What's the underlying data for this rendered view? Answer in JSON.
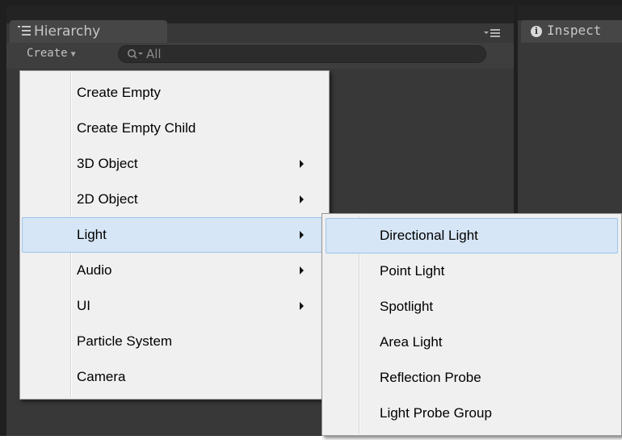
{
  "hierarchy": {
    "tab_label": "Hierarchy",
    "create_label": "Create",
    "search_placeholder": "All"
  },
  "inspector": {
    "tab_label": "Inspect"
  },
  "create_menu": {
    "items": [
      {
        "label": "Create Empty",
        "submenu": false
      },
      {
        "label": "Create Empty Child",
        "submenu": false
      },
      {
        "label": "3D Object",
        "submenu": true
      },
      {
        "label": "2D Object",
        "submenu": true
      },
      {
        "label": "Light",
        "submenu": true,
        "highlighted": true
      },
      {
        "label": "Audio",
        "submenu": true
      },
      {
        "label": "UI",
        "submenu": true
      },
      {
        "label": "Particle System",
        "submenu": false
      },
      {
        "label": "Camera",
        "submenu": false
      }
    ]
  },
  "light_submenu": {
    "items": [
      {
        "label": "Directional Light",
        "highlighted": true
      },
      {
        "label": "Point Light"
      },
      {
        "label": "Spotlight"
      },
      {
        "label": "Area Light"
      },
      {
        "label": "Reflection Probe"
      },
      {
        "label": "Light Probe Group"
      }
    ]
  },
  "colors": {
    "menu_background": "#f0f0f0",
    "highlight": "#d6e6f7",
    "highlight_border": "#9ec4ec",
    "editor_dark": "#383838"
  },
  "icons": {
    "hierarchy_tab": "list-icon",
    "tab_menu": "tab-menu-icon",
    "search": "search-icon",
    "inspector_tab": "info-icon",
    "submenu": "submenu-arrow-icon"
  }
}
